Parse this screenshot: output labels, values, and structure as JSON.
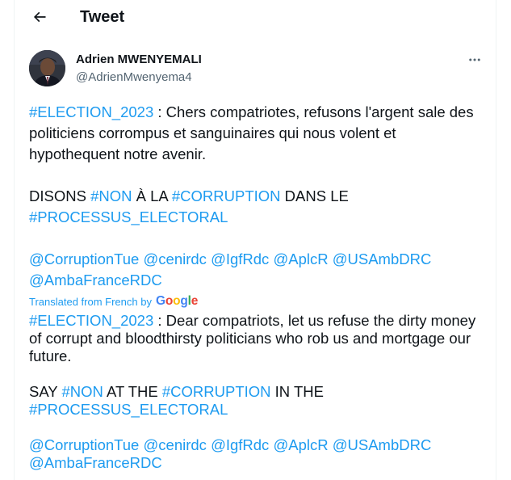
{
  "header": {
    "title": "Tweet"
  },
  "author": {
    "name": "Adrien MWENYEMALI",
    "handle": "@AdrienMwenyema4"
  },
  "tweet": {
    "line1_tag": "#ELECTION_2023",
    "line1_text": " : Chers compatriotes, refusons l'argent sale des politiciens corrompus et sanguinaires qui nous volent et hypothequent notre avenir.",
    "line2_text_a": "DISONS ",
    "line2_tag_a": "#NON",
    "line2_text_b": " À LA ",
    "line2_tag_b": "#CORRUPTION",
    "line2_text_c": " DANS LE",
    "line3_tag": "#PROCESSUS_ELECTORAL",
    "mentions": [
      "@CorruptionTue",
      "@cenirdc",
      "@IgfRdc",
      "@AplcR",
      "@USAmbDRC",
      "@AmbaFranceRDC"
    ]
  },
  "translation_label": "Translated from French by",
  "google_logo": {
    "g1": "G",
    "o1": "o",
    "o2": "o",
    "g2": "g",
    "l": "l",
    "e": "e"
  },
  "translation": {
    "line1_tag": "#ELECTION_2023",
    "line1_text": " : Dear compatriots, let us refuse the dirty money of corrupt and bloodthirsty politicians who rob us and mortgage our future.",
    "line2_text_a": "SAY ",
    "line2_tag_a": "#NON",
    "line2_text_b": " AT THE ",
    "line2_tag_b": "#CORRUPTION",
    "line2_text_c": " IN THE",
    "line3_tag": "#PROCESSUS_ELECTORAL",
    "mentions": [
      "@CorruptionTue",
      "@cenirdc",
      "@IgfRdc",
      "@AplcR",
      "@USAmbDRC",
      "@AmbaFranceRDC"
    ]
  },
  "colors": {
    "link": "#1d9bf0",
    "text": "#0f1419",
    "muted": "#536471"
  },
  "icons": {
    "back": "arrow-left-icon",
    "more": "more-horizontal-icon"
  }
}
